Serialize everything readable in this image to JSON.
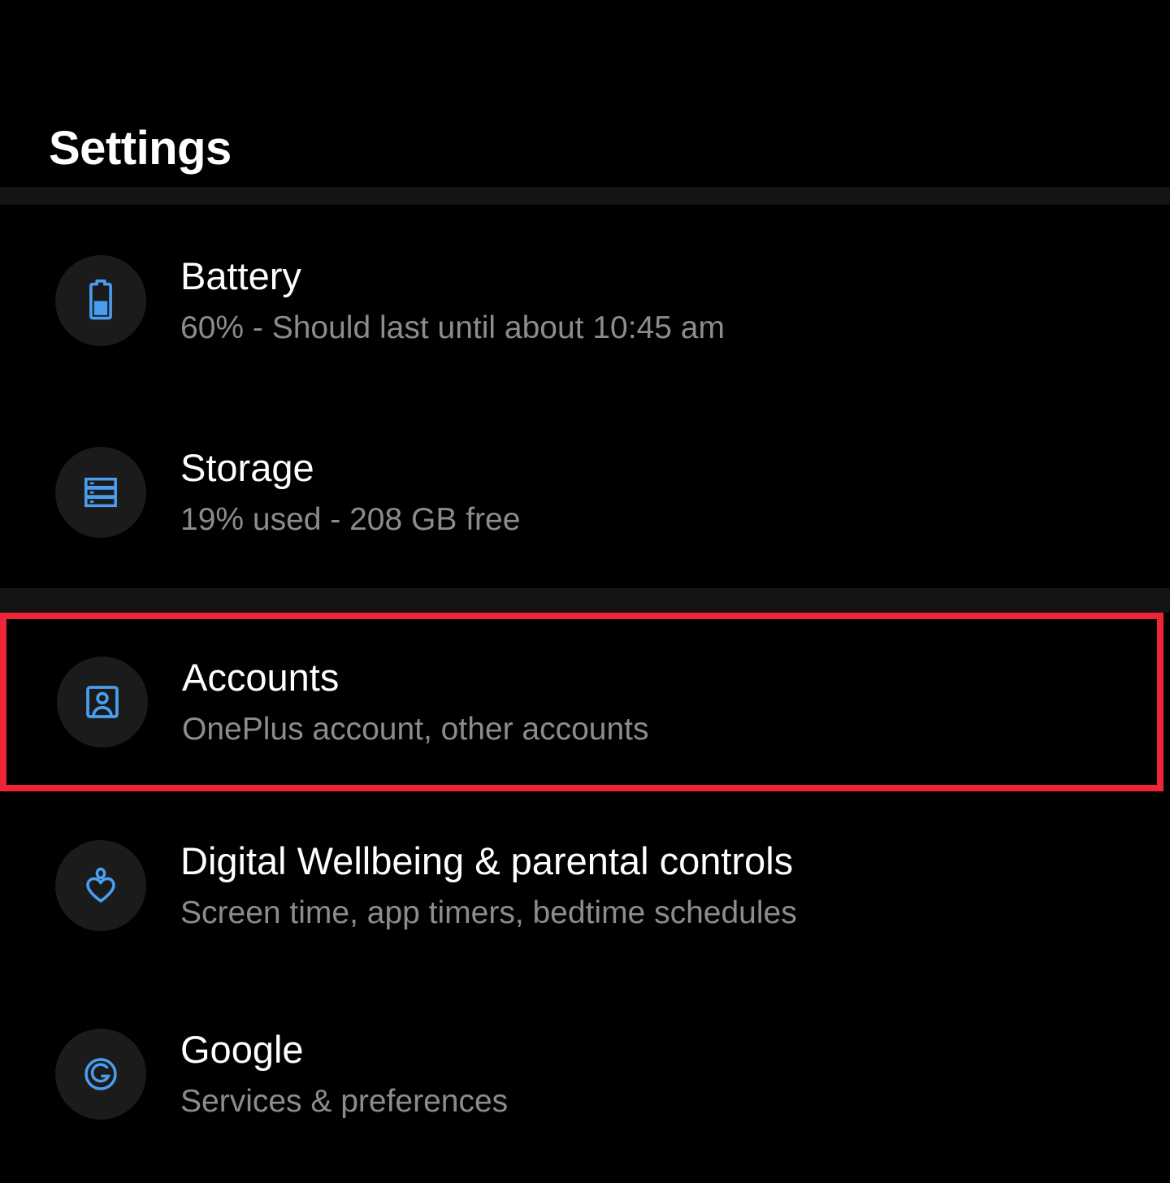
{
  "header": {
    "title": "Settings"
  },
  "accent": {
    "icon_blue": "#4a9ef0",
    "icon_circle_bg": "#1b1b1b",
    "highlight_red": "#ee2536",
    "background": "#000000",
    "title_color": "#ffffff",
    "subtitle_color": "#8c8c8c",
    "divider_color": "#141414"
  },
  "groups": [
    {
      "name": "device-group",
      "items": [
        {
          "id": "battery",
          "icon": "battery-icon",
          "title": "Battery",
          "subtitle": "60% - Should last until about 10:45 am",
          "highlighted": false
        },
        {
          "id": "storage",
          "icon": "storage-icon",
          "title": "Storage",
          "subtitle": "19% used - 208 GB free",
          "highlighted": false
        }
      ]
    },
    {
      "name": "personal-group",
      "items": [
        {
          "id": "accounts",
          "icon": "account-box-icon",
          "title": "Accounts",
          "subtitle": "OnePlus account, other accounts",
          "highlighted": true
        },
        {
          "id": "digital-wellbeing",
          "icon": "digital-wellbeing-icon",
          "title": "Digital Wellbeing & parental controls",
          "subtitle": "Screen time, app timers, bedtime schedules",
          "highlighted": false
        },
        {
          "id": "google",
          "icon": "google-g-icon",
          "title": "Google",
          "subtitle": "Services & preferences",
          "highlighted": false
        }
      ]
    }
  ]
}
